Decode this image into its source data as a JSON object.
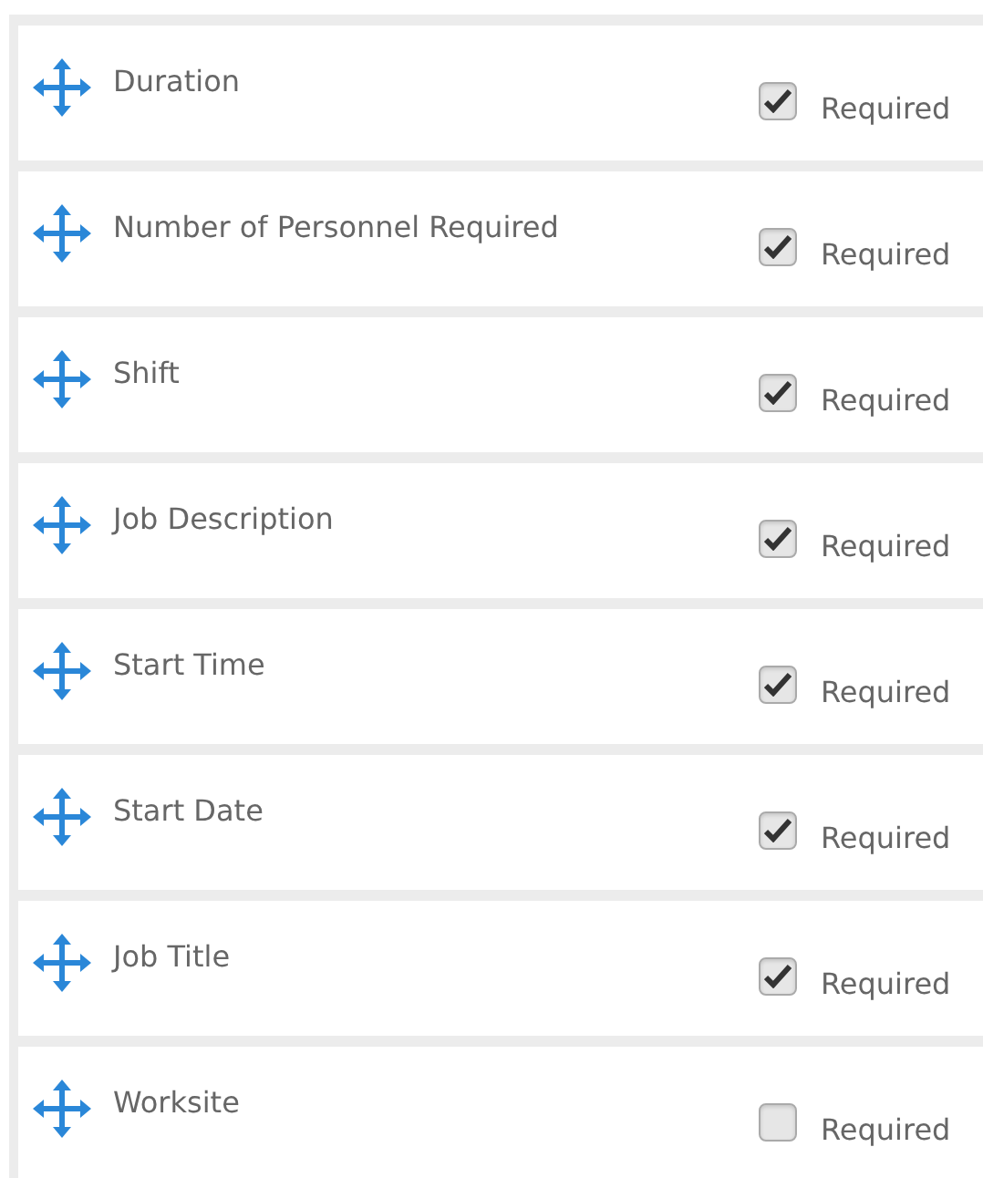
{
  "fields": [
    {
      "label": "Duration",
      "checked": true,
      "option": "Required"
    },
    {
      "label": "Number of Personnel Required",
      "checked": true,
      "option": "Required"
    },
    {
      "label": "Shift",
      "checked": true,
      "option": "Required"
    },
    {
      "label": "Job Description",
      "checked": true,
      "option": "Required"
    },
    {
      "label": "Start Time",
      "checked": true,
      "option": "Required"
    },
    {
      "label": "Start Date",
      "checked": true,
      "option": "Required"
    },
    {
      "label": "Job Title",
      "checked": true,
      "option": "Required"
    },
    {
      "label": "Worksite",
      "checked": false,
      "option": "Required"
    }
  ]
}
